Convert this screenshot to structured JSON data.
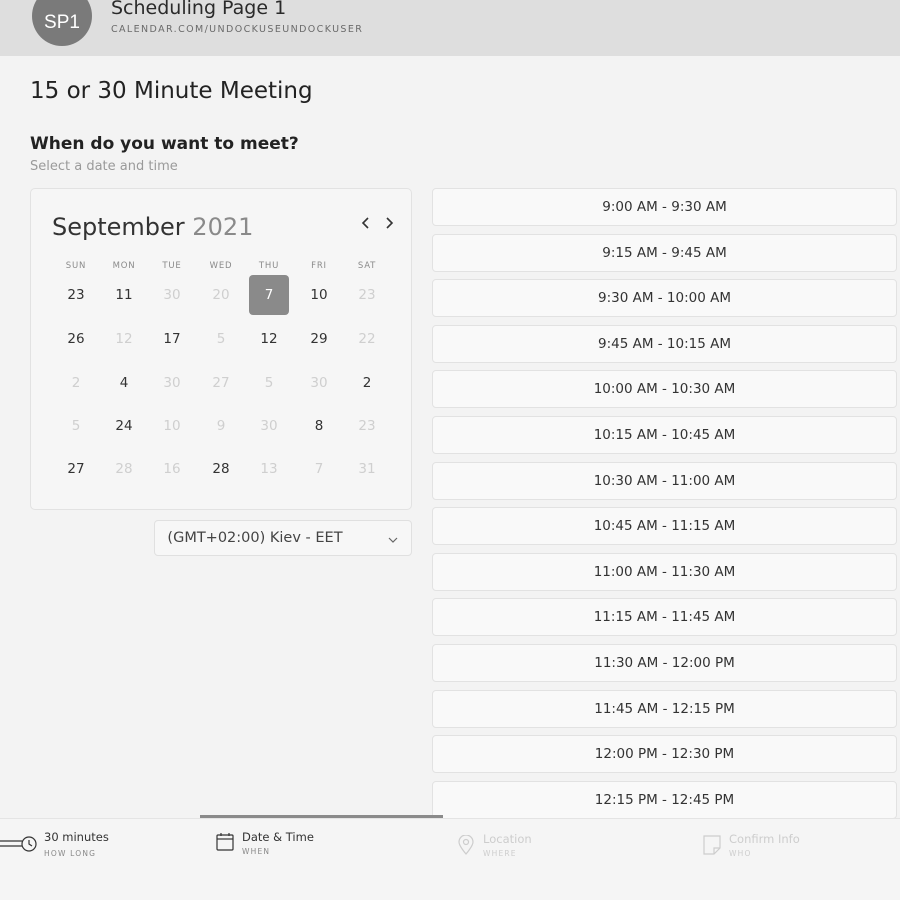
{
  "header": {
    "avatar_initials": "SP1",
    "title": "Scheduling Page 1",
    "url": "CALENDAR.COM/UNDOCKUSEUNDOCKUSER"
  },
  "page_title": "15 or 30 Minute Meeting",
  "question": "When do you want to meet?",
  "subtitle": "Select a date and time",
  "calendar": {
    "month": "September",
    "year": "2021",
    "prev_icon": "chevron-left-icon",
    "next_icon": "chevron-right-icon",
    "weekdays": [
      "SUN",
      "MON",
      "TUE",
      "WED",
      "THU",
      "FRI",
      "SAT"
    ],
    "weeks": [
      [
        {
          "d": "23"
        },
        {
          "d": "11"
        },
        {
          "d": "30",
          "dim": true
        },
        {
          "d": "20",
          "dim": true
        },
        {
          "d": "7",
          "selected": true
        },
        {
          "d": "10"
        },
        {
          "d": "23",
          "dim": true
        }
      ],
      [
        {
          "d": "26"
        },
        {
          "d": "12",
          "dim": true
        },
        {
          "d": "17"
        },
        {
          "d": "5",
          "dim": true
        },
        {
          "d": "12"
        },
        {
          "d": "29"
        },
        {
          "d": "22",
          "dim": true
        }
      ],
      [
        {
          "d": "2",
          "dim": true
        },
        {
          "d": "4"
        },
        {
          "d": "30",
          "dim": true
        },
        {
          "d": "27",
          "dim": true
        },
        {
          "d": "5",
          "dim": true
        },
        {
          "d": "30",
          "dim": true
        },
        {
          "d": "2"
        }
      ],
      [
        {
          "d": "5",
          "dim": true
        },
        {
          "d": "24"
        },
        {
          "d": "10",
          "dim": true
        },
        {
          "d": "9",
          "dim": true
        },
        {
          "d": "30",
          "dim": true
        },
        {
          "d": "8"
        },
        {
          "d": "23",
          "dim": true
        }
      ],
      [
        {
          "d": "27"
        },
        {
          "d": "28",
          "dim": true
        },
        {
          "d": "16",
          "dim": true
        },
        {
          "d": "28"
        },
        {
          "d": "13",
          "dim": true
        },
        {
          "d": "7",
          "dim": true
        },
        {
          "d": "31",
          "dim": true
        }
      ]
    ]
  },
  "timezone": {
    "value": "(GMT+02:00) Kiev - EET",
    "icon": "chevron-down-icon"
  },
  "time_slots": [
    "9:00 AM - 9:30 AM",
    "9:15 AM - 9:45 AM",
    "9:30 AM - 10:00 AM",
    "9:45 AM - 10:15 AM",
    "10:00 AM - 10:30 AM",
    "10:15 AM - 10:45 AM",
    "10:30 AM - 11:00 AM",
    "10:45 AM - 11:15 AM",
    "11:00 AM - 11:30 AM",
    "11:15 AM - 11:45 AM",
    "11:30 AM - 12:00 PM",
    "11:45 AM - 12:15 PM",
    "12:00 PM - 12:30 PM",
    "12:15 PM - 12:45 PM"
  ],
  "steps": [
    {
      "label": "30 minutes",
      "sub": "HOW LONG",
      "icon": "clock-icon",
      "state": "done"
    },
    {
      "label": "Date & Time",
      "sub": "WHEN",
      "icon": "calendar-icon",
      "state": "active"
    },
    {
      "label": "Location",
      "sub": "WHERE",
      "icon": "location-pin-icon",
      "state": "upcoming"
    },
    {
      "label": "Confirm Info",
      "sub": "WHO",
      "icon": "note-icon",
      "state": "upcoming"
    }
  ],
  "colors": {
    "header_bg": "#dedede",
    "page_bg": "#f3f3f3",
    "selected_day": "#8a8a8a",
    "dim_text": "#cfcfcf"
  }
}
